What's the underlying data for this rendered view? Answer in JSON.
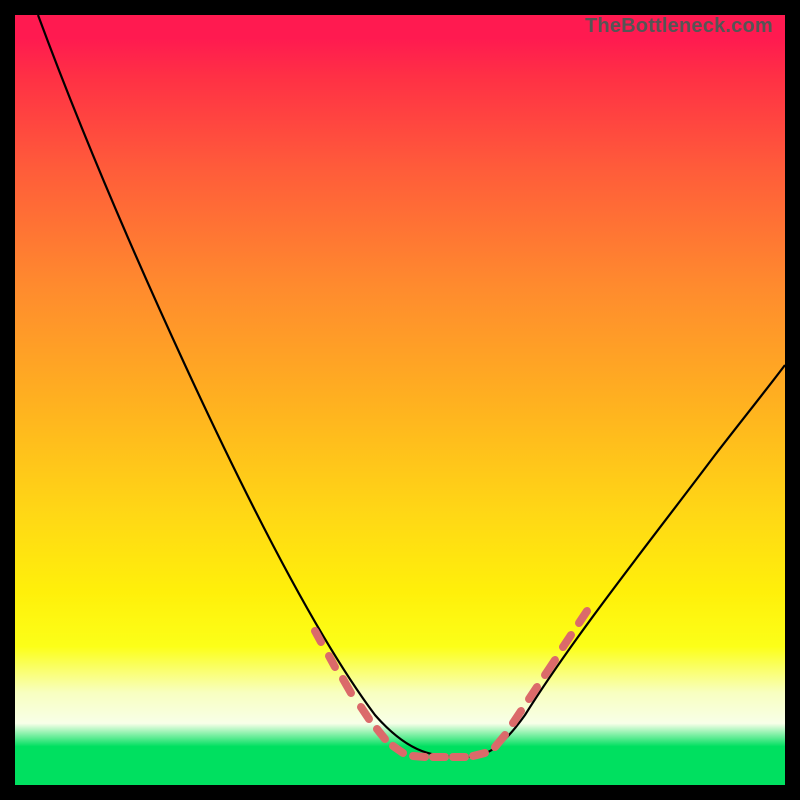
{
  "watermark": "TheBottleneck.com",
  "chart_data": {
    "type": "line",
    "title": "",
    "xlabel": "",
    "ylabel": "",
    "xlim": [
      0,
      100
    ],
    "ylim": [
      0,
      100
    ],
    "series": [
      {
        "name": "bottleneck-curve",
        "x": [
          3,
          8,
          15,
          22,
          30,
          38,
          44,
          48,
          52,
          55,
          58,
          60,
          63,
          66,
          72,
          80,
          90,
          100
        ],
        "y": [
          100,
          90,
          76,
          62,
          47,
          32,
          20,
          12,
          7,
          5,
          4,
          4,
          4,
          6,
          12,
          23,
          40,
          58
        ]
      }
    ],
    "highlight_segments": {
      "name": "pink-dots",
      "left_arm_x_range": [
        40,
        55
      ],
      "right_arm_x_range": [
        63,
        75
      ],
      "bottom_y_approx": 5
    },
    "background_gradient": {
      "top": "#ff1a50",
      "mid_upper": "#ff8a2e",
      "mid": "#ffd815",
      "mid_lower": "#f8ffc0",
      "bottom": "#00e060"
    }
  }
}
